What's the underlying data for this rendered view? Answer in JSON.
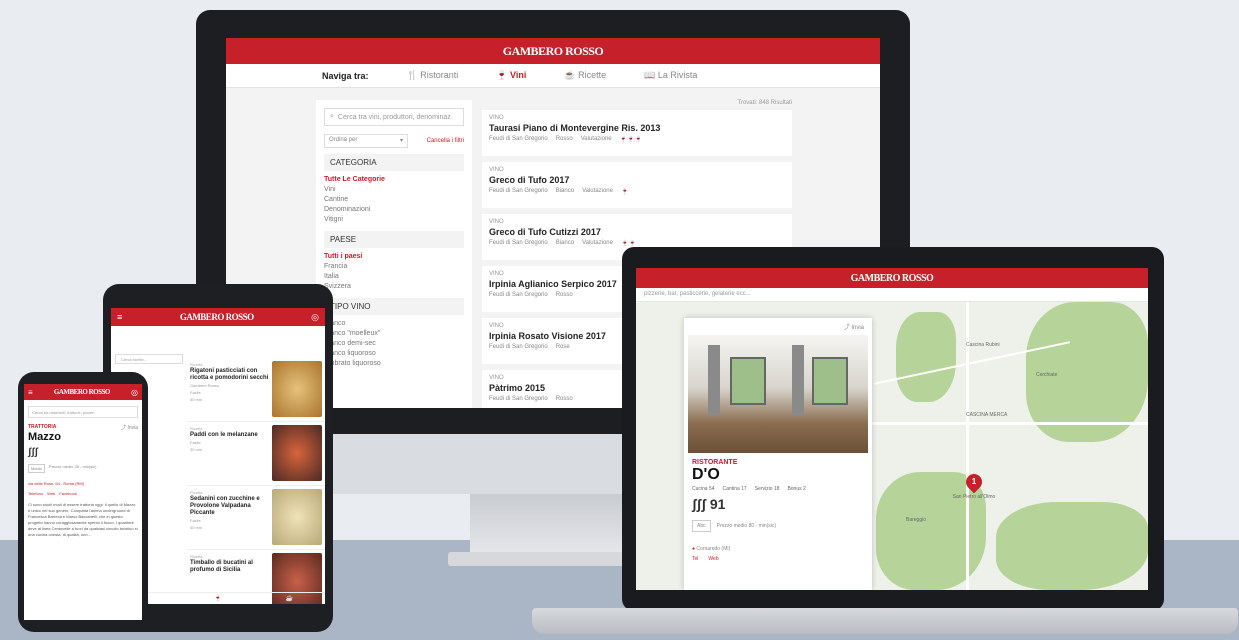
{
  "brand": {
    "name": "GAMBERO ROSSO",
    "accent": "#c6202a"
  },
  "desktop": {
    "nav": {
      "label": "Naviga tra:",
      "items": [
        {
          "icon": "fork-knife-icon",
          "label": "Ristoranti"
        },
        {
          "icon": "wine-glass-icon",
          "label": "Vini",
          "active": true
        },
        {
          "icon": "recipe-icon",
          "label": "Ricette"
        },
        {
          "icon": "magazine-icon",
          "label": "La Rivista"
        }
      ]
    },
    "sidebar": {
      "search_placeholder": "Cerca tra vini, produttori, denominaz",
      "sort_label": "Ordina per",
      "cancel_filters": "Cancella i filtri",
      "category_title": "CATEGORIA",
      "category_all": "Tutte Le Categorie",
      "categories": [
        "Vini",
        "Cantine",
        "Denominazioni",
        "Vitigni"
      ],
      "country_title": "PAESE",
      "country_all": "Tutti i paesi",
      "countries": [
        "Francia",
        "Italia",
        "Svizzera"
      ],
      "type_title": "TIPO VINO",
      "types": [
        "Bianco",
        "Bianco \"moelleux\"",
        "Bianco demi-sec",
        "Bianco liquoroso",
        "Ambrato liquoroso"
      ]
    },
    "results_note": "Trovati: 848 Risultati",
    "cards": [
      {
        "cat": "VINO",
        "title": "Taurasi Piano di Montevergine Ris. 2013",
        "producer": "Feudi di San Gregorio",
        "color": "Rosso",
        "rating": "Valutazione"
      },
      {
        "cat": "VINO",
        "title": "Greco di Tufo 2017",
        "producer": "Feudi di San Gregorio",
        "color": "Bianco",
        "rating": "Valutazione"
      },
      {
        "cat": "VINO",
        "title": "Greco di Tufo Cutizzi 2017",
        "producer": "Feudi di San Gregorio",
        "color": "Bianco",
        "rating": "Valutazione"
      },
      {
        "cat": "VINO",
        "title": "Irpinia Aglianico Serpico 2017",
        "producer": "Feudi di San Gregorio",
        "color": "Rosso",
        "rating": ""
      },
      {
        "cat": "VINO",
        "title": "Irpinia Rosato Visione 2017",
        "producer": "Feudi di San Gregorio",
        "color": "Rose",
        "rating": ""
      },
      {
        "cat": "VINO",
        "title": "Pàtrimo 2015",
        "producer": "Feudi di San Gregorio",
        "color": "Rosso",
        "rating": ""
      }
    ]
  },
  "laptop": {
    "search_text": "pizzerie, bar, pasticcerie, gelaterie ecc...",
    "share": "Invia",
    "category": "RISTORANTE",
    "name": "D'O",
    "scores": [
      "Cucina 54",
      "Cantina 17",
      "Servizio 18",
      "Bonus 2"
    ],
    "forks_score": "91",
    "price_tag": "Abc",
    "price_text": "Prezzo medio 80 - min(sic)",
    "address": "Cornaredo (MI)",
    "contacts": [
      "Tel",
      "Web"
    ],
    "map_pin": "1",
    "map_pin_label": "San Pietro all'Olmo",
    "map_labels": [
      "CASCINA MERCA",
      "Cascina Rubini",
      "Cerchiate",
      "Bareggio"
    ]
  },
  "tablet": {
    "search_placeholder": "Cerca ricette...",
    "recipes": [
      {
        "cat": "Ricetta",
        "title": "Rigatoni pasticciati con ricotta e pomodorini secchi",
        "author": "Gambero Rosso",
        "level": "Facile",
        "time": "30 min",
        "color": "#d9a25a"
      },
      {
        "cat": "Ricetta",
        "title": "Paddi con le melanzane",
        "level": "Facile",
        "time": "30 min",
        "color": "#c84a2c"
      },
      {
        "cat": "Ricetta",
        "title": "Sedanini con zucchine e Provolone Valpadana Piccante",
        "level": "Facile",
        "time": "40 min",
        "color": "#dcd1a8"
      },
      {
        "cat": "Ricetta",
        "title": "Timballo di bucatini al profumo di Sicilia",
        "level": "",
        "time": "",
        "color": "#b94a32"
      }
    ]
  },
  "phone": {
    "search_placeholder": "Cerca tra ristoranti, trattorie, pizzeri",
    "share": "Invia",
    "category": "TRATTORIA",
    "name": "Mazzo",
    "forks": "ʃʃʃ",
    "price_tag": "Medio",
    "price_text": "Prezzo medio 35 - min(sic)",
    "address": "via delle Rose, 54 - Roma (RM)",
    "contacts": [
      "Telefono",
      "Web",
      "Facebook"
    ],
    "body": "Ci sono stuoli modi di essere trattoria oggi: il quello di Mazzo è unico nel suo genere. Compatta l'anima underground di Francesca Barreca e Marco Baccanelli, che in questo progetto hanno coraggiosamente spento il fuoco. I quartiere deve al linea Centocelle a fuori da qualsiasi circuito turistico si una cucina onesta, di qualità, uno..."
  }
}
